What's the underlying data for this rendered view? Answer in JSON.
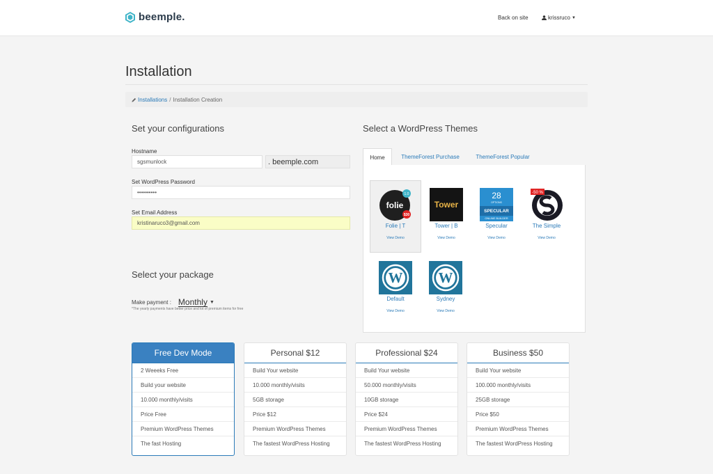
{
  "header": {
    "logo_text": "beemple.",
    "back_link": "Back on site",
    "username": "krissruco"
  },
  "page": {
    "title": "Installation",
    "breadcrumb": {
      "link": "Installations",
      "separator": "/",
      "current": "Installation Creation"
    }
  },
  "config": {
    "heading": "Set your configurations",
    "hostname_label": "Hostname",
    "hostname_value": "sgsmunlock",
    "domain_suffix": ". beemple.com",
    "password_label": "Set WordPress Password",
    "password_value": "••••••••••",
    "email_label": "Set Email Address",
    "email_value": "kristinaruco3@gmail.com"
  },
  "package": {
    "heading": "Select your package",
    "payment_label": "Make payment :",
    "payment_value": "Monthly",
    "note": "*The yearly payments have better price and lot of premium items for free"
  },
  "themes": {
    "heading": "Select a WordPress Themes",
    "tabs": [
      "Home",
      "ThemeForest Purchase",
      "ThemeForest Popular"
    ],
    "items": [
      {
        "name": "Folie | T",
        "demo": "View Demo",
        "icon": "folie-thumb",
        "badge_top": "1.0",
        "badge_bottom": "$30",
        "thumb_text": "folie"
      },
      {
        "name": "Tower | B",
        "demo": "View Demo",
        "icon": "tower-thumb",
        "thumb_text": "Tower"
      },
      {
        "name": "Specular",
        "demo": "View Demo",
        "icon": "specular-thumb",
        "thumb_text": "SPECULAR",
        "thumb_num": "28",
        "thumb_small": "OPTIONS",
        "thumb_sub": "ONLINE BUILDER"
      },
      {
        "name": "The Simple",
        "demo": "View Demo",
        "icon": "simple-thumb",
        "badge": "-50 %"
      },
      {
        "name": "Default",
        "demo": "View Demo",
        "icon": "wordpress-icon"
      },
      {
        "name": "Sydney",
        "demo": "View Demo",
        "icon": "wordpress-icon"
      }
    ]
  },
  "plans": [
    {
      "title": "Free Dev Mode",
      "features": [
        "2 Weeeks Free",
        "Build your website",
        "10.000 monthly/visits",
        "Price Free",
        "Premium WordPress Themes",
        "The fast Hosting"
      ]
    },
    {
      "title": "Personal $12",
      "features": [
        "Build Your website",
        "10.000 monthly/visits",
        "5GB storage",
        "Price $12",
        "Premium WordPress Themes",
        "The fastest WordPress Hosting"
      ]
    },
    {
      "title": "Professional $24",
      "features": [
        "Build Your website",
        "50.000 monthly/visits",
        "10GB storage",
        "Price $24",
        "Premium WordPress Themes",
        "The fastest WordPress Hosting"
      ]
    },
    {
      "title": "Business $50",
      "features": [
        "Build Your website",
        "100.000 monthly/visits",
        "25GB storage",
        "Price $50",
        "Premium WordPress Themes",
        "The fastest WordPress Hosting"
      ]
    }
  ],
  "colors": {
    "accent": "#3a81c1",
    "link": "#2a7ab8",
    "wordpress_blue": "#21759b"
  }
}
